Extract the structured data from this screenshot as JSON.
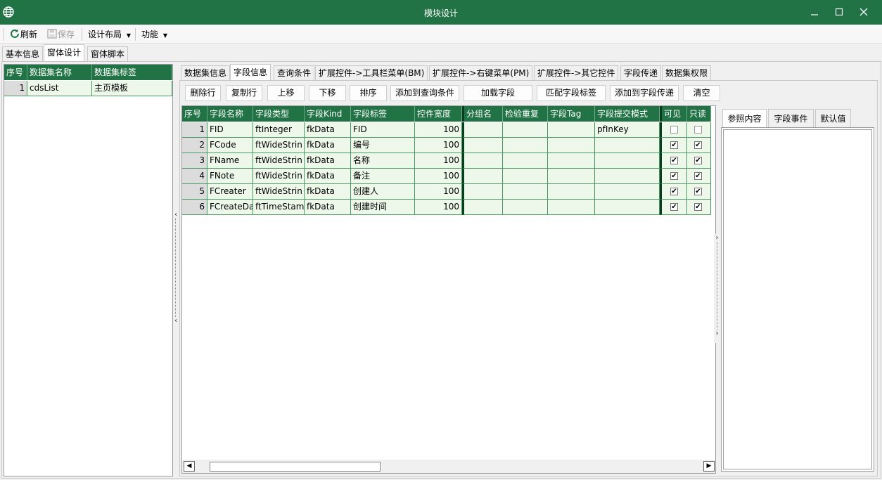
{
  "window": {
    "title": "模块设计"
  },
  "toolbar": {
    "refresh": "刷新",
    "save": "保存",
    "layout": "设计布局",
    "functions": "功能"
  },
  "outer_tabs": [
    "基本信息",
    "窗体设计",
    "窗体脚本"
  ],
  "dataset_grid": {
    "headers": [
      "序号",
      "数据集名称",
      "数据集标签"
    ],
    "rows": [
      {
        "index": "1",
        "name": "cdsList",
        "label": "主页模板"
      }
    ]
  },
  "inner_tabs": [
    "数据集信息",
    "字段信息",
    "查询条件",
    "扩展控件->工具栏菜单(BM)",
    "扩展控件->右键菜单(PM)",
    "扩展控件->其它控件",
    "字段传递",
    "数据集权限"
  ],
  "buttons": [
    "删除行",
    "复制行",
    "上移",
    "下移",
    "排序",
    "添加到查询条件",
    "加载字段",
    "匹配字段标签",
    "添加到字段传递",
    "清空"
  ],
  "field_grid": {
    "headers": [
      "序号",
      "字段名称",
      "字段类型",
      "字段Kind",
      "字段标签",
      "控件宽度",
      "分组名",
      "检验重复",
      "字段Tag",
      "字段提交模式",
      "可见",
      "只读"
    ],
    "rows": [
      {
        "index": "1",
        "name": "FID",
        "type": "ftInteger",
        "kind": "fkData",
        "label": "FID",
        "width": "100",
        "group": "",
        "check": "",
        "tag": "",
        "mode": "pfInKey",
        "visible": false,
        "readonly": false
      },
      {
        "index": "2",
        "name": "FCode",
        "type": "ftWideStrin",
        "kind": "fkData",
        "label": "编号",
        "width": "100",
        "group": "",
        "check": "",
        "tag": "",
        "mode": "",
        "visible": true,
        "readonly": true
      },
      {
        "index": "3",
        "name": "FName",
        "type": "ftWideStrin",
        "kind": "fkData",
        "label": "名称",
        "width": "100",
        "group": "",
        "check": "",
        "tag": "",
        "mode": "",
        "visible": true,
        "readonly": true
      },
      {
        "index": "4",
        "name": "FNote",
        "type": "ftWideStrin",
        "kind": "fkData",
        "label": "备注",
        "width": "100",
        "group": "",
        "check": "",
        "tag": "",
        "mode": "",
        "visible": true,
        "readonly": true
      },
      {
        "index": "5",
        "name": "FCreater",
        "type": "ftWideStrin",
        "kind": "fkData",
        "label": "创建人",
        "width": "100",
        "group": "",
        "check": "",
        "tag": "",
        "mode": "",
        "visible": true,
        "readonly": true
      },
      {
        "index": "6",
        "name": "FCreateDa",
        "type": "ftTimeStam",
        "kind": "fkData",
        "label": "创建时间",
        "width": "100",
        "group": "",
        "check": "",
        "tag": "",
        "mode": "",
        "visible": true,
        "readonly": true
      }
    ]
  },
  "right_tabs": [
    "参照内容",
    "字段事件",
    "默认值"
  ],
  "colors": {
    "brand": "#217346",
    "row_bg": "#eef8ea"
  }
}
